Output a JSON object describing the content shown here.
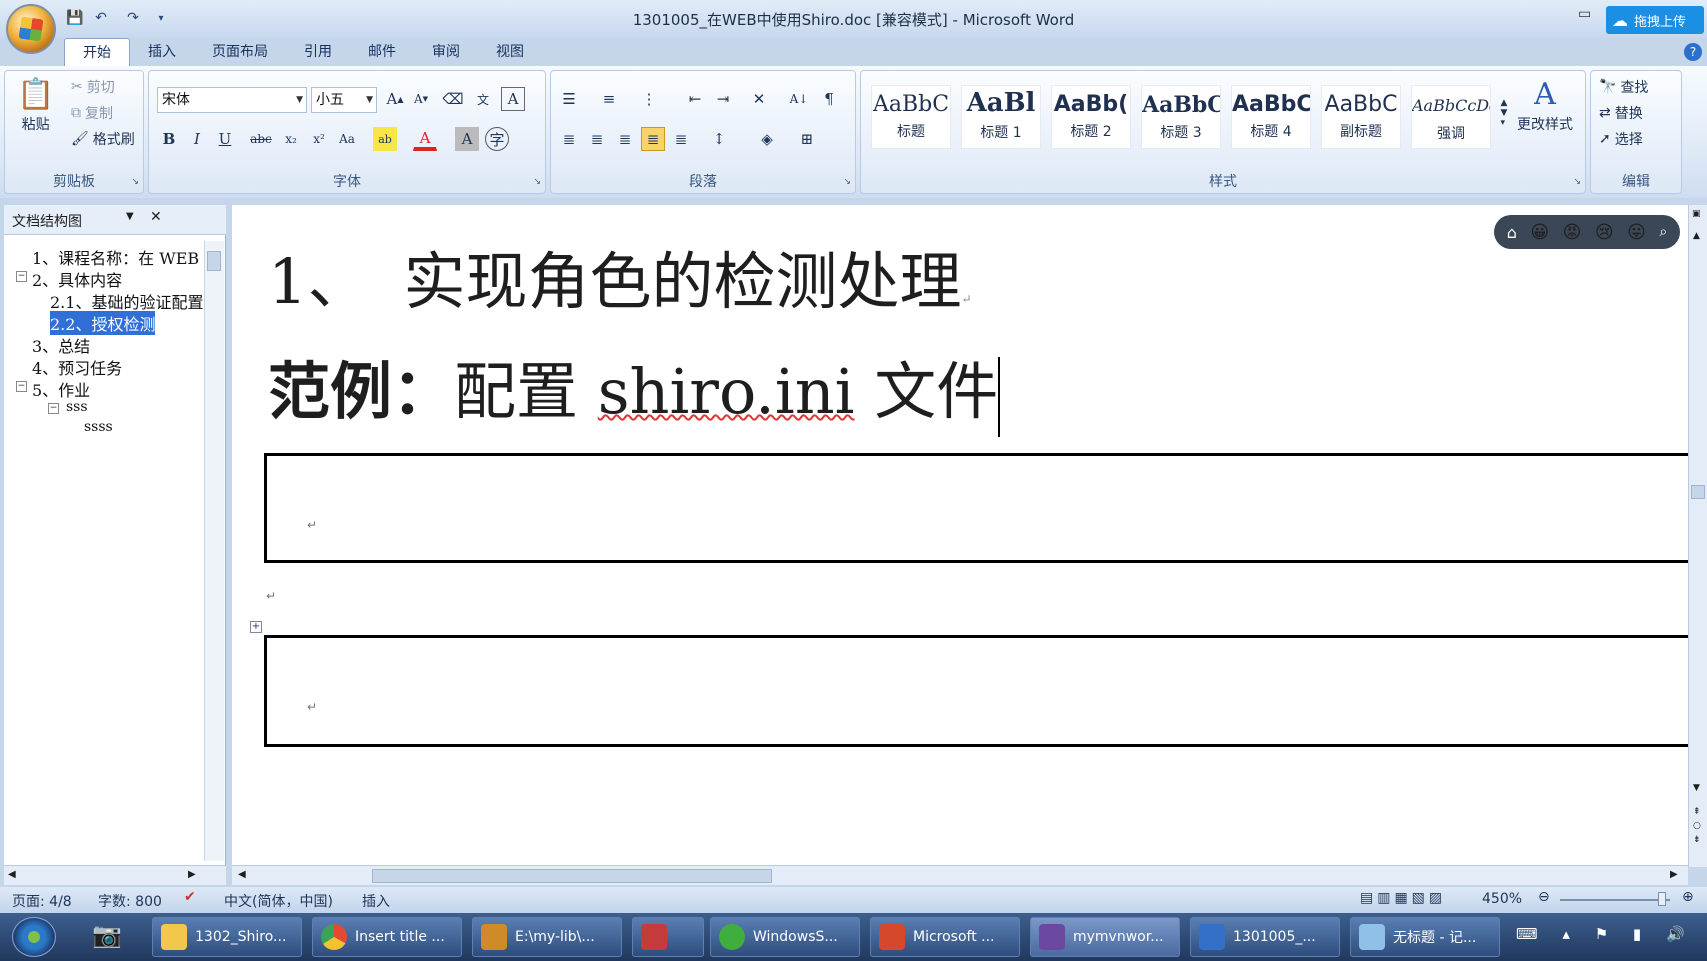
{
  "window": {
    "title": "1301005_在WEB中使用Shiro.doc [兼容模式] - Microsoft Word",
    "upload_label": "拖拽上传"
  },
  "tabs": [
    "开始",
    "插入",
    "页面布局",
    "引用",
    "邮件",
    "审阅",
    "视图"
  ],
  "ribbon": {
    "clipboard": {
      "paste": "粘贴",
      "cut": "剪切",
      "copy": "复制",
      "format_painter": "格式刷",
      "label": "剪贴板"
    },
    "font": {
      "name": "宋体",
      "size": "小五",
      "label": "字体"
    },
    "paragraph": {
      "label": "段落"
    },
    "styles": {
      "items": [
        {
          "preview": "AaBbC",
          "name": "标题"
        },
        {
          "preview": "AaBl",
          "name": "标题 1"
        },
        {
          "preview": "AaBb(",
          "name": "标题 2"
        },
        {
          "preview": "AaBbC",
          "name": "标题 3"
        },
        {
          "preview": "AaBbC",
          "name": "标题 4"
        },
        {
          "preview": "AaBbC",
          "name": "副标题"
        },
        {
          "preview": "AaBbCcDd",
          "name": "强调"
        }
      ],
      "change": "更改样式",
      "label": "样式"
    },
    "editing": {
      "find": "查找",
      "replace": "替换",
      "select": "选择",
      "label": "编辑"
    }
  },
  "nav": {
    "title": "文档结构图",
    "items": [
      {
        "text": "1、课程名称：在 WEB"
      },
      {
        "text": "2、具体内容"
      },
      {
        "text": "2.1、基础的验证配置"
      },
      {
        "text": "2.2、授权检测"
      },
      {
        "text": "3、总结"
      },
      {
        "text": "4、预习任务"
      },
      {
        "text": "5、作业"
      },
      {
        "text": "sss"
      },
      {
        "text": "ssss"
      }
    ]
  },
  "document": {
    "heading_num": "1、",
    "heading_text": "实现角色的检测处理",
    "example_label": "范例：",
    "example_text_1": "配置 ",
    "example_file": "shiro.ini",
    "example_text_2": " 文件",
    "para_mark": "↵"
  },
  "status": {
    "page": "页面: 4/8",
    "words": "字数: 800",
    "language": "中文(简体，中国)",
    "mode": "插入",
    "zoom": "450%"
  },
  "taskbar": [
    {
      "label": "1302_Shiro...",
      "color": "#f2c74c"
    },
    {
      "label": "Insert title ...",
      "color": "#e24a32"
    },
    {
      "label": "E:\\my-lib\\...",
      "color": "#d08a2a"
    },
    {
      "label": "",
      "color": "#c53a3a"
    },
    {
      "label": "WindowsS...",
      "color": "#3fae3f"
    },
    {
      "label": "Microsoft ...",
      "color": "#d5492a"
    },
    {
      "label": "mymvnwor...",
      "color": "#6a4aa0"
    },
    {
      "label": "1301005_...",
      "color": "#3470c8"
    },
    {
      "label": "无标题 - 记...",
      "color": "#8fc1e8"
    }
  ]
}
